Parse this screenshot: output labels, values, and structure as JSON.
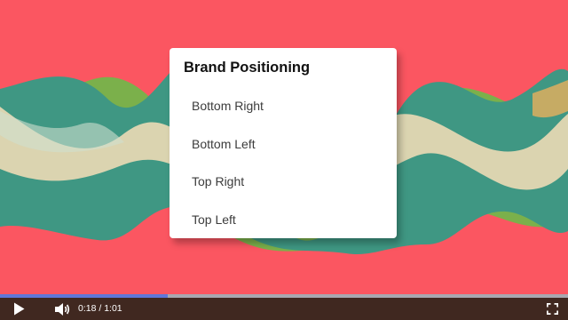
{
  "menu": {
    "title": "Brand Positioning",
    "items": [
      {
        "label": "Bottom Right"
      },
      {
        "label": "Bottom Left"
      },
      {
        "label": "Top Right"
      },
      {
        "label": "Top Left"
      }
    ]
  },
  "player": {
    "current_time": "0:18",
    "separator": "/",
    "duration": "1:01",
    "progress": 0.295
  },
  "icons": {
    "play": "play-icon",
    "volume": "volume-icon",
    "fullscreen": "fullscreen-icon"
  },
  "colors": {
    "background": "#fb5661",
    "progress_fill": "#5f77d9",
    "progress_track": "#a8a8b0",
    "control_bar": "#402820",
    "wave_teal": "#3f9783",
    "wave_green": "#7bb04b",
    "wave_yellow": "#e0dc54",
    "wave_cream": "#e8d9b4"
  }
}
